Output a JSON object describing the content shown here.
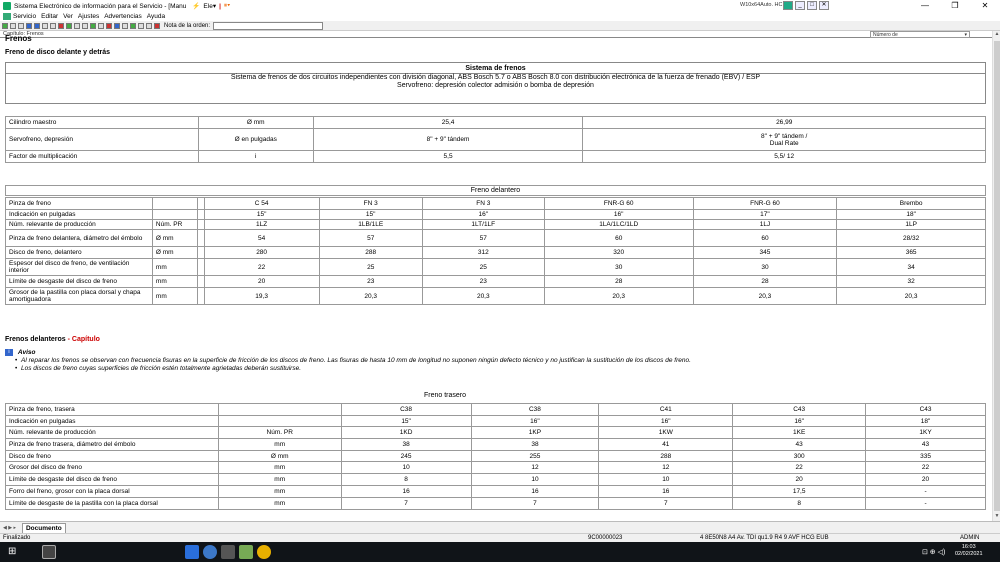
{
  "window": {
    "title": "Sistema Electrónico de información para el Servicio - [Manu",
    "quick_tools": [
      "⚡",
      "Ele▾",
      "|",
      "⏸▾"
    ],
    "right_info": "W10x64Auto. HC",
    "controls": [
      "—",
      "❐",
      "✕"
    ]
  },
  "menubar": {
    "items": [
      "Servicio",
      "Editar",
      "Ver",
      "Ajustes",
      "Advertencias",
      "Ayuda"
    ]
  },
  "toolbar": {
    "note_label": "Nota de la orden:",
    "note_value": ""
  },
  "header": {
    "breadcrumb": "Capítulo: Frenos",
    "dropdown": "Número de"
  },
  "page": {
    "title": "Frenos",
    "subtitle": "Freno de disco delante y detrás"
  },
  "system": {
    "header": "Sistema de frenos",
    "line1": "Sistema de frenos de dos circuitos independientes con división diagonal, ABS Bosch 5.7 o ABS Bosch 8.0 con distribución electrónica de la fuerza de frenado (EBV) / ESP",
    "line2": "Servofreno: depresión colector admisión o bomba de depresión"
  },
  "master_table": {
    "rows": [
      [
        "Cilindro maestro",
        "Ø mm",
        "25,4",
        "26,99"
      ],
      [
        "Servofreno, depresión",
        "Ø en pulgadas",
        "8\" + 9\" tándem",
        "8\" + 9\" tándem /\nDual Rate"
      ],
      [
        "Factor de multiplicación",
        "i",
        "5,5",
        "5,5/ 12"
      ]
    ]
  },
  "front_table": {
    "caption": "Freno delantero",
    "rows": [
      [
        "Pinza de freno",
        "",
        "",
        "C 54",
        "FN 3",
        "FN 3",
        "FNR-G 60",
        "FNR-G 60",
        "Brembo"
      ],
      [
        "Indicación en pulgadas",
        "",
        "",
        "15\"",
        "15\"",
        "16\"",
        "16\"",
        "17\"",
        "18\""
      ],
      [
        "Núm. relevante de producción",
        "Núm. PR",
        "",
        "1LZ",
        "1LB/1LE",
        "1LT/1LF",
        "1LA/1LC/1LD",
        "1LJ",
        "1LP"
      ],
      [
        "Pinza de freno delantera, diámetro del émbolo",
        "Ø mm",
        "",
        "54",
        "57",
        "57",
        "60",
        "60",
        "28/32"
      ],
      [
        "Disco de freno, delantero",
        "Ø mm",
        "",
        "280",
        "288",
        "312",
        "320",
        "345",
        "365"
      ],
      [
        "Espesor del disco de freno, de ventilación interior",
        "mm",
        "",
        "22",
        "25",
        "25",
        "30",
        "30",
        "34"
      ],
      [
        "Límite de desgaste del disco de freno",
        "mm",
        "",
        "20",
        "23",
        "23",
        "28",
        "28",
        "32"
      ],
      [
        "Grosor de la pastilla con placa dorsal y chapa amortiguadora",
        "mm",
        "",
        "19,3",
        "20,3",
        "20,3",
        "20,3",
        "20,3",
        "20,3"
      ]
    ]
  },
  "frenos_delanteros": {
    "label": "Frenos delanteros",
    "link": "- Capítulo"
  },
  "aviso": {
    "icon": "i",
    "title": "Aviso",
    "items": [
      "Al reparar los frenos se observan con frecuencia fisuras en la superficie de fricción de los discos de freno. Las fisuras de hasta 10 mm de longitud no suponen ningún defecto técnico y no justifican la sustitución de los discos de freno.",
      "Los discos de freno cuyas superficies de fricción estén totalmente agrietadas deberán sustituirse."
    ]
  },
  "rear_table": {
    "caption": "Freno trasero",
    "rows": [
      [
        "Pinza de freno, trasera",
        "",
        "C38",
        "C38",
        "C41",
        "C43",
        "C43"
      ],
      [
        "Indicación en pulgadas",
        "",
        "15\"",
        "16\"",
        "16\"",
        "16\"",
        "18\""
      ],
      [
        "Núm. relevante de producción",
        "Núm. PR",
        "1KD",
        "1KP",
        "1KW",
        "1KE",
        "1KY"
      ],
      [
        "Pinza de freno trasera, diámetro del émbolo",
        "mm",
        "38",
        "38",
        "41",
        "43",
        "43"
      ],
      [
        "Disco de freno",
        "Ø mm",
        "245",
        "255",
        "288",
        "300",
        "335"
      ],
      [
        "Grosor del disco de freno",
        "mm",
        "10",
        "12",
        "12",
        "22",
        "22"
      ],
      [
        "Límite de desgaste del disco de freno",
        "mm",
        "8",
        "10",
        "10",
        "20",
        "20"
      ],
      [
        "Forro del freno, grosor con la placa dorsal",
        "mm",
        "16",
        "16",
        "16",
        "17,5",
        "-"
      ],
      [
        "Límite de desgaste de la pastilla con la placa dorsal",
        "mm",
        "7",
        "7",
        "7",
        "8",
        "-"
      ]
    ]
  },
  "doc_tab": {
    "label": "Documento"
  },
  "statusbar": {
    "left": "Finalizado",
    "middle": "9C00000023",
    "right": "4 8E50N8 A4 Av. TDI qu1.9 R4 9 AVF HCG EUB",
    "user": "ADMIN"
  },
  "taskbar": {
    "time": "16:03",
    "date": "02/02/2021",
    "tray": "⊡ ⊕ ◁)"
  }
}
